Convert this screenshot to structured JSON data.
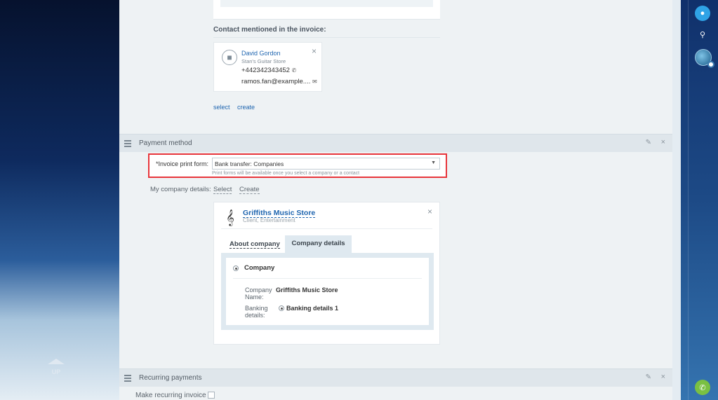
{
  "contact_section": {
    "label": "Contact mentioned in the invoice:",
    "contact": {
      "name": "David Gordon",
      "company": "Stan's Guitar Store",
      "phone": "+442342343452",
      "email": "ramos.fan@example...."
    },
    "select_label": "select",
    "create_label": "create"
  },
  "payment_section": {
    "title": "Payment method",
    "print_form_label": "*Invoice print form:",
    "print_form_value": "Bank transfer: Companies",
    "print_form_hint": "Print forms will be available once you select a company or a contact",
    "my_company_label": "My company details:",
    "my_company_select": "Select",
    "my_company_create": "Create",
    "company_card": {
      "name": "Griffiths Music Store",
      "subtitle": "Client, Entertainment",
      "tab_about": "About company",
      "tab_details": "Company details",
      "radio_company": "Company",
      "company_name_label": "Company Name:",
      "company_name_value": "Griffiths Music Store",
      "banking_label": "Banking details:",
      "banking_value": "Banking details 1"
    }
  },
  "recurring_section": {
    "title": "Recurring payments",
    "make_recurring_label": "Make recurring invoice"
  },
  "sidebar": {
    "up_label": "UP",
    "icons": [
      "bell-icon",
      "search-icon",
      "avatar",
      "phone-icon"
    ]
  },
  "colors": {
    "accent_link": "#2066b0",
    "highlight_border": "#e8353b",
    "phone_button": "#7ac043",
    "bell_button": "#2fa3e6"
  }
}
